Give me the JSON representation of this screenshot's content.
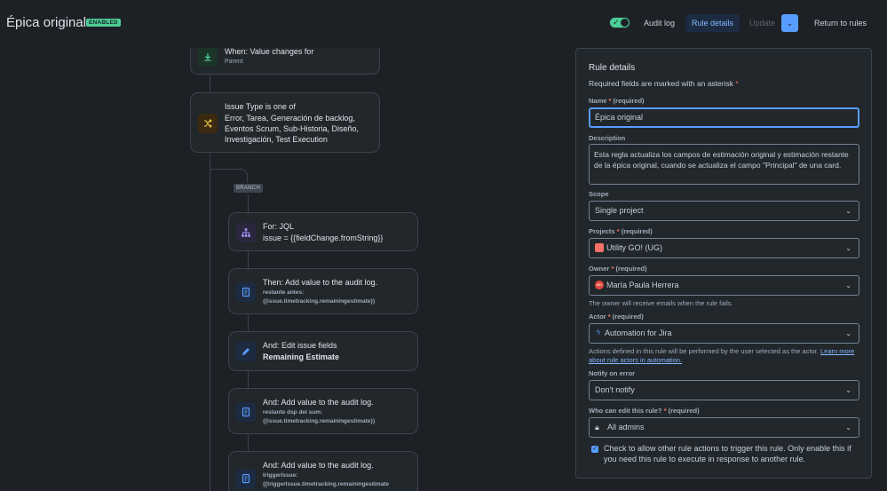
{
  "header": {
    "title": "Épica original",
    "status_badge": "ENABLED",
    "audit_log": "Audit log",
    "rule_details": "Rule details",
    "update": "Update",
    "return": "Return to rules"
  },
  "canvas": {
    "branch_label": "BRANCH",
    "cards": [
      {
        "title": "When: Value changes for",
        "sub": "Parent",
        "icon": "download-arrow-icon"
      },
      {
        "title": "Issue Type is one of",
        "body": [
          "Error, Tarea, Generación de backlog,",
          "Eventos Scrum, Sub-Historia, Diseño,",
          "Investigación, Test Execution"
        ],
        "icon": "shuffle-icon"
      },
      {
        "title": "For: JQL",
        "body": [
          "issue = {{fieldChange.fromString}}"
        ],
        "icon": "hierarchy-icon"
      },
      {
        "title": "Then: Add value to the audit log.",
        "mono": [
          "restante antes:",
          "{{issue.timetracking.remainingestimate}}"
        ],
        "icon": "document-icon"
      },
      {
        "title": "And: Edit issue fields",
        "bold": "Remaining Estimate",
        "icon": "pencil-icon"
      },
      {
        "title": "And: Add value to the audit log.",
        "mono": [
          "restante dsp del sum:",
          "{{issue.timetracking.remainingestimate}}"
        ],
        "icon": "document-icon"
      },
      {
        "title": "And: Add value to the audit log.",
        "mono": [
          "triggerIssue:",
          "{{triggerIssue.timetracking.remainingestimate"
        ],
        "icon": "document-icon"
      }
    ]
  },
  "panel": {
    "heading": "Rule details",
    "required_note": "Required fields are marked with an asterisk",
    "asterisk": "*",
    "required_tag": "(required)",
    "name_label": "Name",
    "name_value": "Épica original",
    "description_label": "Description",
    "description_value": "Esta regla actualiza los campos de estimación original y estimación restante de la épica original, cuando se actualiza el campo \"Principal\" de una card.",
    "scope_label": "Scope",
    "scope_value": "Single project",
    "projects_label": "Projects",
    "projects_value": "Utility GO! (UG)",
    "owner_label": "Owner",
    "owner_value": "María Paula Herrera",
    "owner_avatar": "MH",
    "owner_hint": "The owner will receive emails when the rule fails.",
    "actor_label": "Actor",
    "actor_value": "Automation for Jira",
    "actor_hint_1": "Actions defined in this rule will be performed by the user selected as the actor.",
    "actor_hint_link_1": "Learn more",
    "actor_hint_link_2": "about rule actors in automation.",
    "notify_label": "Notify on error",
    "notify_value": "Don't notify",
    "who_label": "Who can edit this rule?",
    "who_value": "All admins",
    "checkbox_text": "Check to allow other rule actions to trigger this rule. Only enable this if you need this rule to execute in response to another rule."
  },
  "colors": {
    "background": "#1d2125",
    "accent": "#579dff",
    "enabled": "#4bce97"
  }
}
